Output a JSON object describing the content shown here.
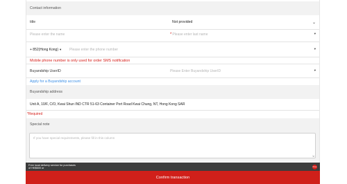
{
  "contact": {
    "header": "Contact information",
    "title_label": "title",
    "title_value": "Not provided",
    "first_name_placeholder": "Please enter the name",
    "last_name_placeholder": "Please enter last name",
    "phone_code": "+ 852(Hong Kong)",
    "phone_placeholder": "Please enter the phone number",
    "phone_note": "Mobile phone number is only used for order SMS notification",
    "buyandship_label": "Buyandship UserID",
    "buyandship_placeholder": "Please Enter Buyandship UserID",
    "apply_link": "Apply for a Buyandship account"
  },
  "address": {
    "header": "Buyandship address",
    "value": "Unit A, 10/F, C/O, Kwai Shun IND CTR 51-63 Container Port Road Kwai Chung, NT, Hong Kong SAR",
    "required_note": "*Required"
  },
  "special_note": {
    "header": "Special note",
    "placeholder": "If you have special requirements, please fill in this column"
  },
  "promo": {
    "text": "Free local delivery service for purchases of HK$600 or",
    "badge": "Free"
  },
  "confirm_label": "Confirm transaction",
  "required_mark": "*"
}
